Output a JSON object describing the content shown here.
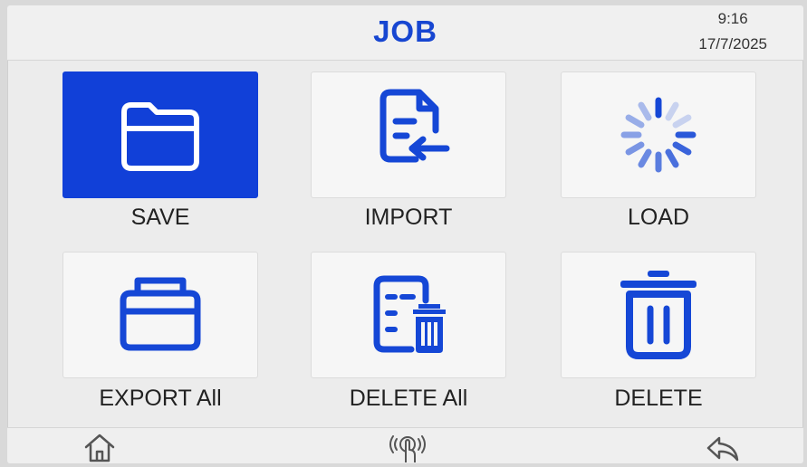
{
  "header": {
    "title": "JOB",
    "time": "9:16",
    "date": "17/7/2025"
  },
  "tiles": [
    {
      "label": "SAVE",
      "icon": "folder-icon",
      "selected": true
    },
    {
      "label": "IMPORT",
      "icon": "file-import-icon",
      "selected": false
    },
    {
      "label": "LOAD",
      "icon": "loading-spinner-icon",
      "selected": false
    },
    {
      "label": "EXPORT All",
      "icon": "export-tray-icon",
      "selected": false
    },
    {
      "label": "DELETE All",
      "icon": "file-trash-icon",
      "selected": false
    },
    {
      "label": "DELETE",
      "icon": "trash-icon",
      "selected": false
    }
  ],
  "footer": {
    "left_icon": "home-icon",
    "center_icon": "touch-icon",
    "right_icon": "back-arrow-icon"
  },
  "colors": {
    "accent": "#1140d8",
    "title": "#1746d1",
    "icon": "#1547d6",
    "background": "#ececec"
  }
}
